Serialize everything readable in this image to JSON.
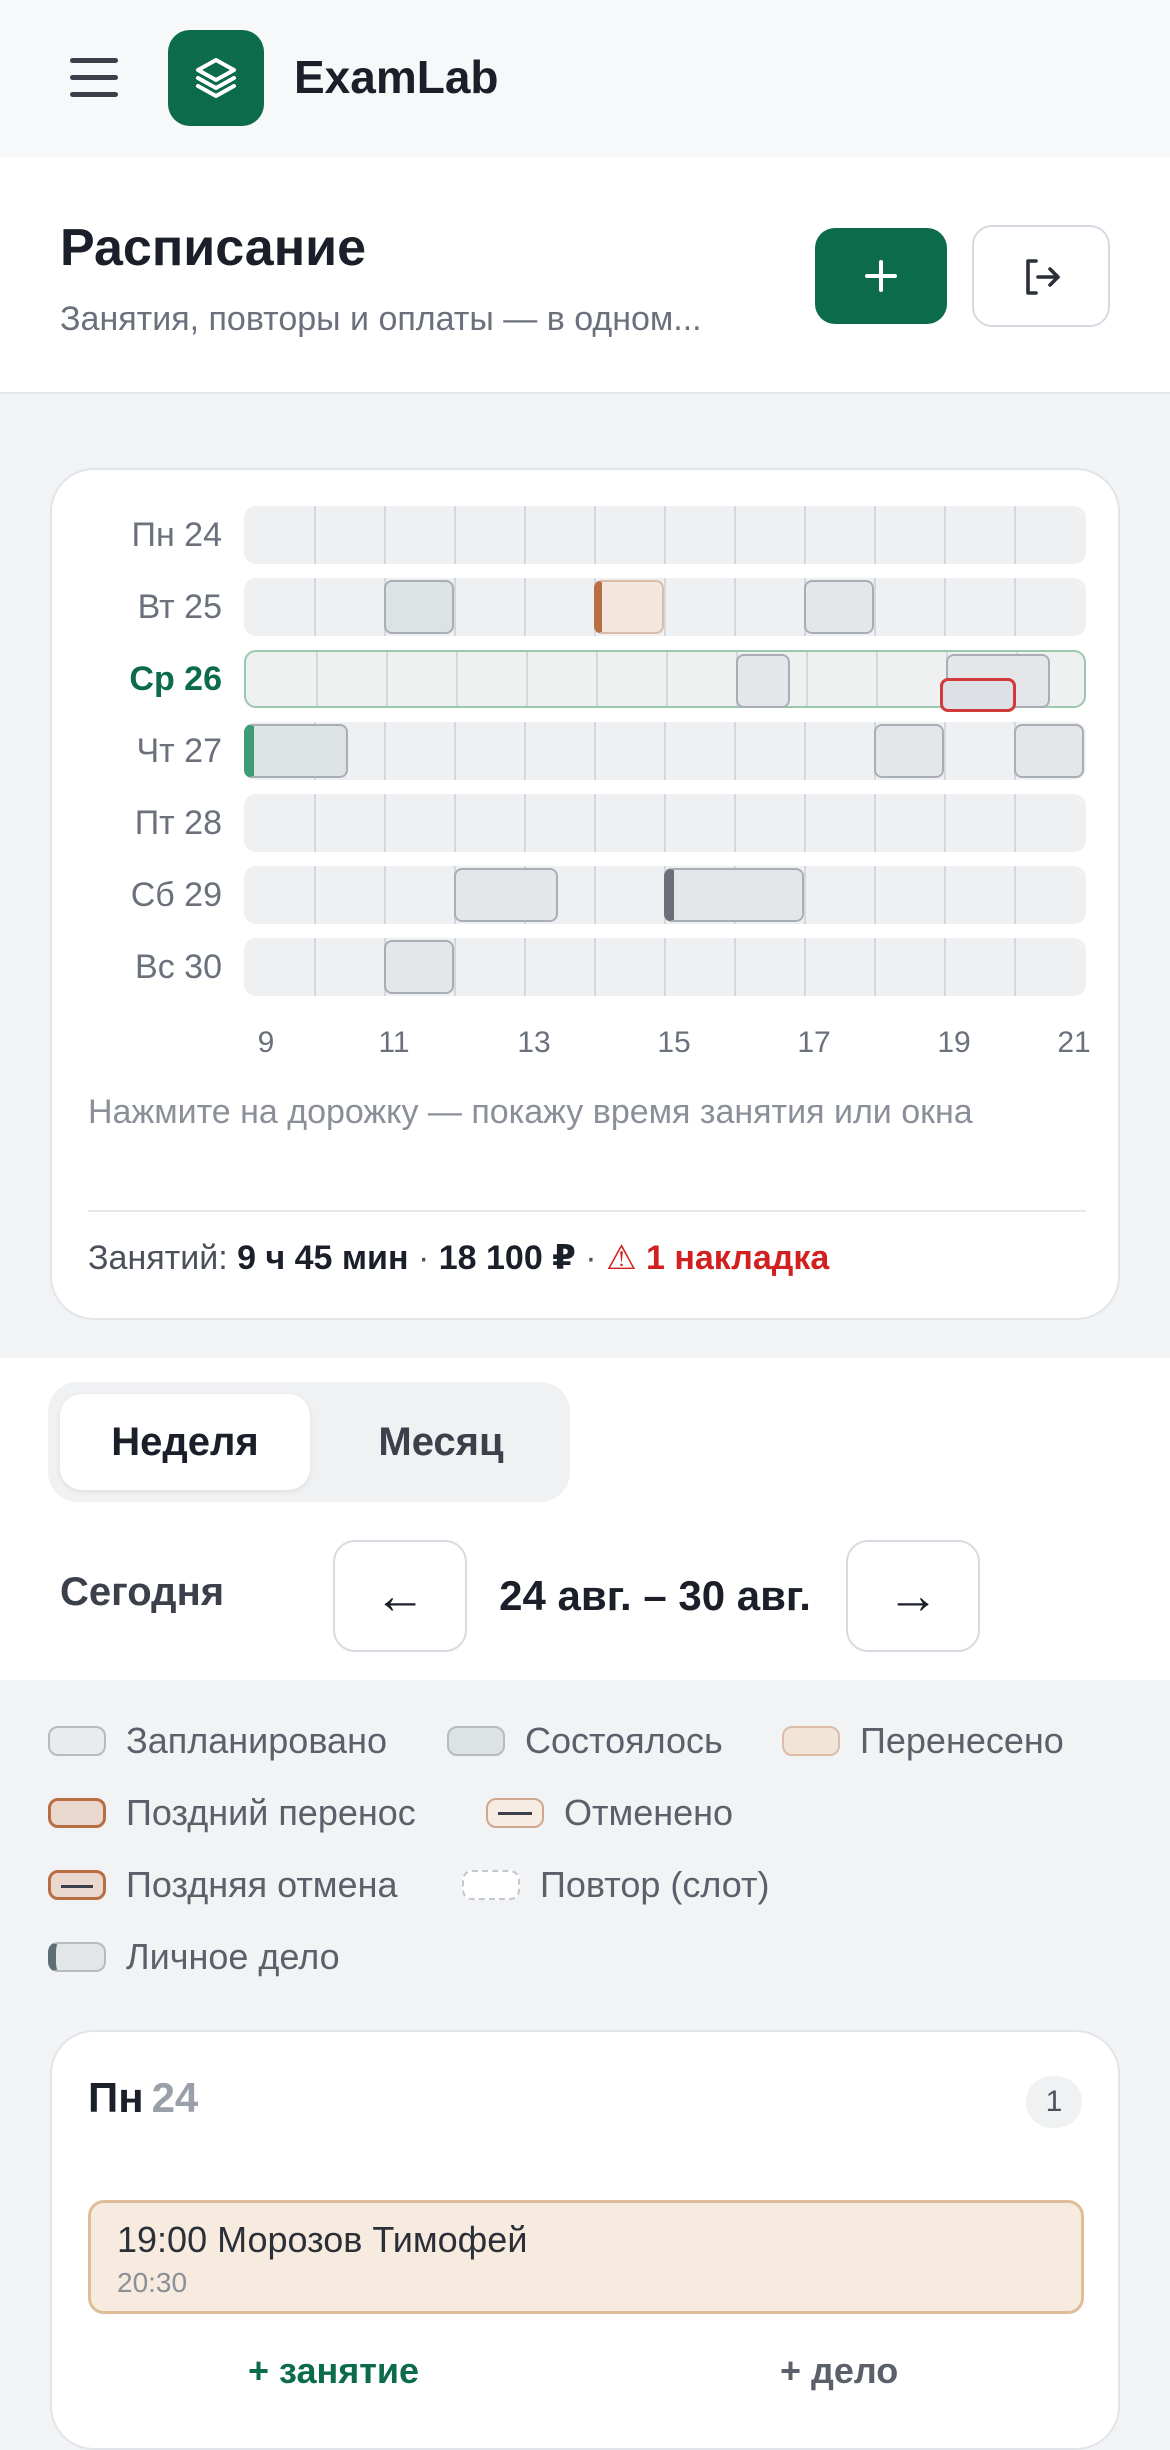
{
  "app": {
    "name": "ExamLab"
  },
  "header": {
    "title": "Расписание",
    "subtitle": "Занятия, повторы и оплаты — в одном..."
  },
  "overview": {
    "days": [
      {
        "label": "Пн 24",
        "today": false
      },
      {
        "label": "Вт 25",
        "today": false
      },
      {
        "label": "Ср 26",
        "today": true
      },
      {
        "label": "Чт 27",
        "today": false
      },
      {
        "label": "Пт 28",
        "today": false
      },
      {
        "label": "Сб 29",
        "today": false
      },
      {
        "label": "Вс 30",
        "today": false
      }
    ],
    "hour_ticks": [
      "9",
      "11",
      "13",
      "15",
      "17",
      "19",
      "21"
    ],
    "hint": "Нажмите на дорожку — покажу время занятия или окна",
    "summary": {
      "prefix": "Занятий:",
      "hours": "9 ч 45 мин",
      "sep1": "·",
      "amount": "18 100 ₽",
      "sep2": "·",
      "warning": "⚠ 1 накладка"
    }
  },
  "view_toggle": {
    "week": "Неделя",
    "month": "Месяц",
    "active": "week"
  },
  "nav": {
    "today": "Сегодня",
    "prev": "←",
    "range": "24 авг. – 30 авг.",
    "next": "→"
  },
  "legend": {
    "planned": "Запланировано",
    "done": "Состоялось",
    "moved": "Перенесено",
    "late_move": "Поздний перенос",
    "cancelled": "Отменено",
    "late_cancel": "Поздняя отмена",
    "repeat_slot": "Повтор (слот)",
    "personal": "Личное дело"
  },
  "day_card": {
    "day": "Пн",
    "date": "24",
    "count": "1",
    "lessons": [
      {
        "title": "19:00 Морозов Тимофей",
        "end": "20:30"
      }
    ],
    "add_lesson": "+ занятие",
    "add_task": "+ дело"
  }
}
